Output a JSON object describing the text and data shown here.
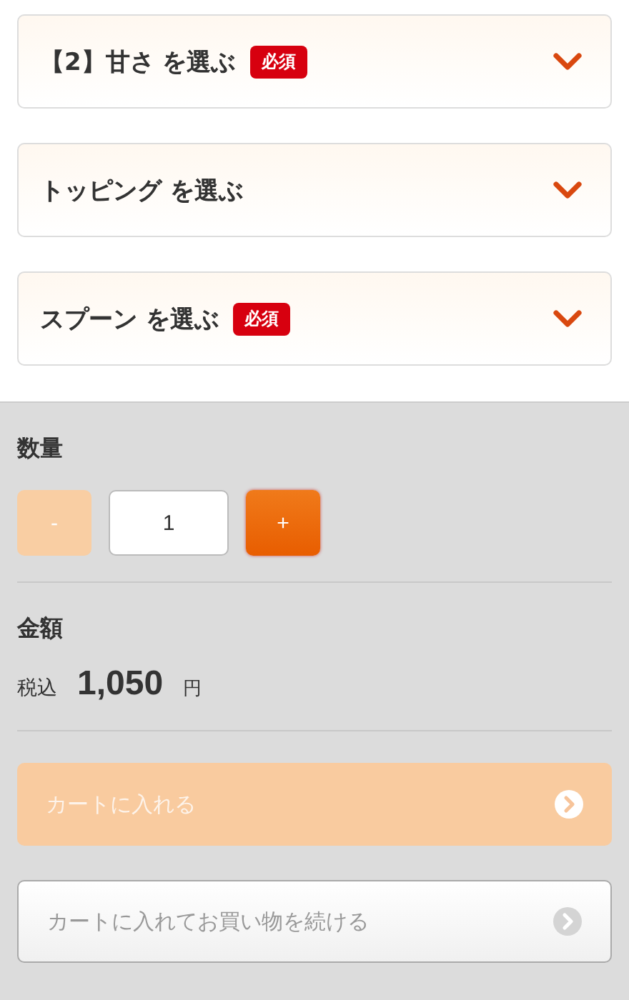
{
  "sections": [
    {
      "title": "【2】甘さ を選ぶ",
      "badge": "必須",
      "expanded": false
    },
    {
      "title": "トッピング を選ぶ",
      "expanded": false
    },
    {
      "title": "スプーン を選ぶ",
      "badge": "必須",
      "expanded": false
    }
  ],
  "quantity": {
    "label": "数量",
    "minus": {
      "label": "-",
      "disabled": true
    },
    "value": "1",
    "plus": {
      "label": "+",
      "disabled": false
    }
  },
  "price": {
    "label": "金額",
    "tax_label": "税込",
    "amount": "1,050",
    "unit": "円"
  },
  "buttons": [
    {
      "label": "カートに入れる",
      "kind": "primary",
      "disabled": true
    },
    {
      "label": "カートに入れてお買い物を続ける",
      "kind": "secondary",
      "disabled": true
    }
  ]
}
